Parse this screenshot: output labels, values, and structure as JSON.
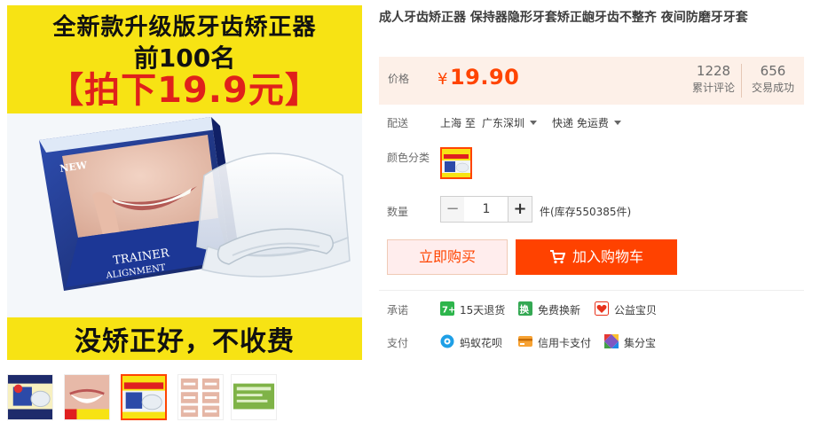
{
  "product": {
    "title": "成人牙齿矫正器 保持器隐形牙套矫正龅牙齿不整齐 夜间防磨牙牙套"
  },
  "main_image": {
    "banner_line1": "全新款升级版牙齿矫正器",
    "banner_line2": "前100名",
    "banner_line3": "【拍下19.9元】",
    "banner_bottom": "没矫正好，不收费",
    "box_text_new": "NEW",
    "box_text_trainer": "TRAINER",
    "box_text_alignment": "ALIGNMENT"
  },
  "thumbnails": [
    {
      "name": "thumb-1",
      "active": false
    },
    {
      "name": "thumb-2",
      "active": false
    },
    {
      "name": "thumb-3",
      "active": true
    },
    {
      "name": "thumb-4",
      "active": false
    },
    {
      "name": "thumb-5",
      "active": false
    }
  ],
  "price": {
    "label": "价格",
    "currency": "¥",
    "value": "19.90",
    "reviews_count": "1228",
    "reviews_label": "累计评论",
    "sales_count": "656",
    "sales_label": "交易成功"
  },
  "shipping": {
    "label": "配送",
    "from": "上海 至",
    "to": "广东深圳",
    "method": "快递 免运费"
  },
  "color": {
    "label": "颜色分类"
  },
  "quantity": {
    "label": "数量",
    "value": "1",
    "minus": "−",
    "plus": "+",
    "stock_text": "件(库存550385件)"
  },
  "actions": {
    "buy_now": "立即购买",
    "add_to_cart": "加入购物车"
  },
  "promise": {
    "label": "承诺",
    "items": [
      {
        "text": "15天退货",
        "icon": "return-15-icon"
      },
      {
        "text": "免费换新",
        "icon": "exchange-icon"
      },
      {
        "text": "公益宝贝",
        "icon": "charity-icon"
      }
    ]
  },
  "payment": {
    "label": "支付",
    "items": [
      {
        "text": "蚂蚁花呗",
        "icon": "huabei-icon"
      },
      {
        "text": "信用卡支付",
        "icon": "credit-card-icon"
      },
      {
        "text": "集分宝",
        "icon": "jifenbao-icon"
      }
    ]
  },
  "colors": {
    "accent": "#ff4400",
    "banner_yellow": "#f7e314",
    "banner_red": "#e0201b",
    "price_bg": "#fdf0e8"
  }
}
